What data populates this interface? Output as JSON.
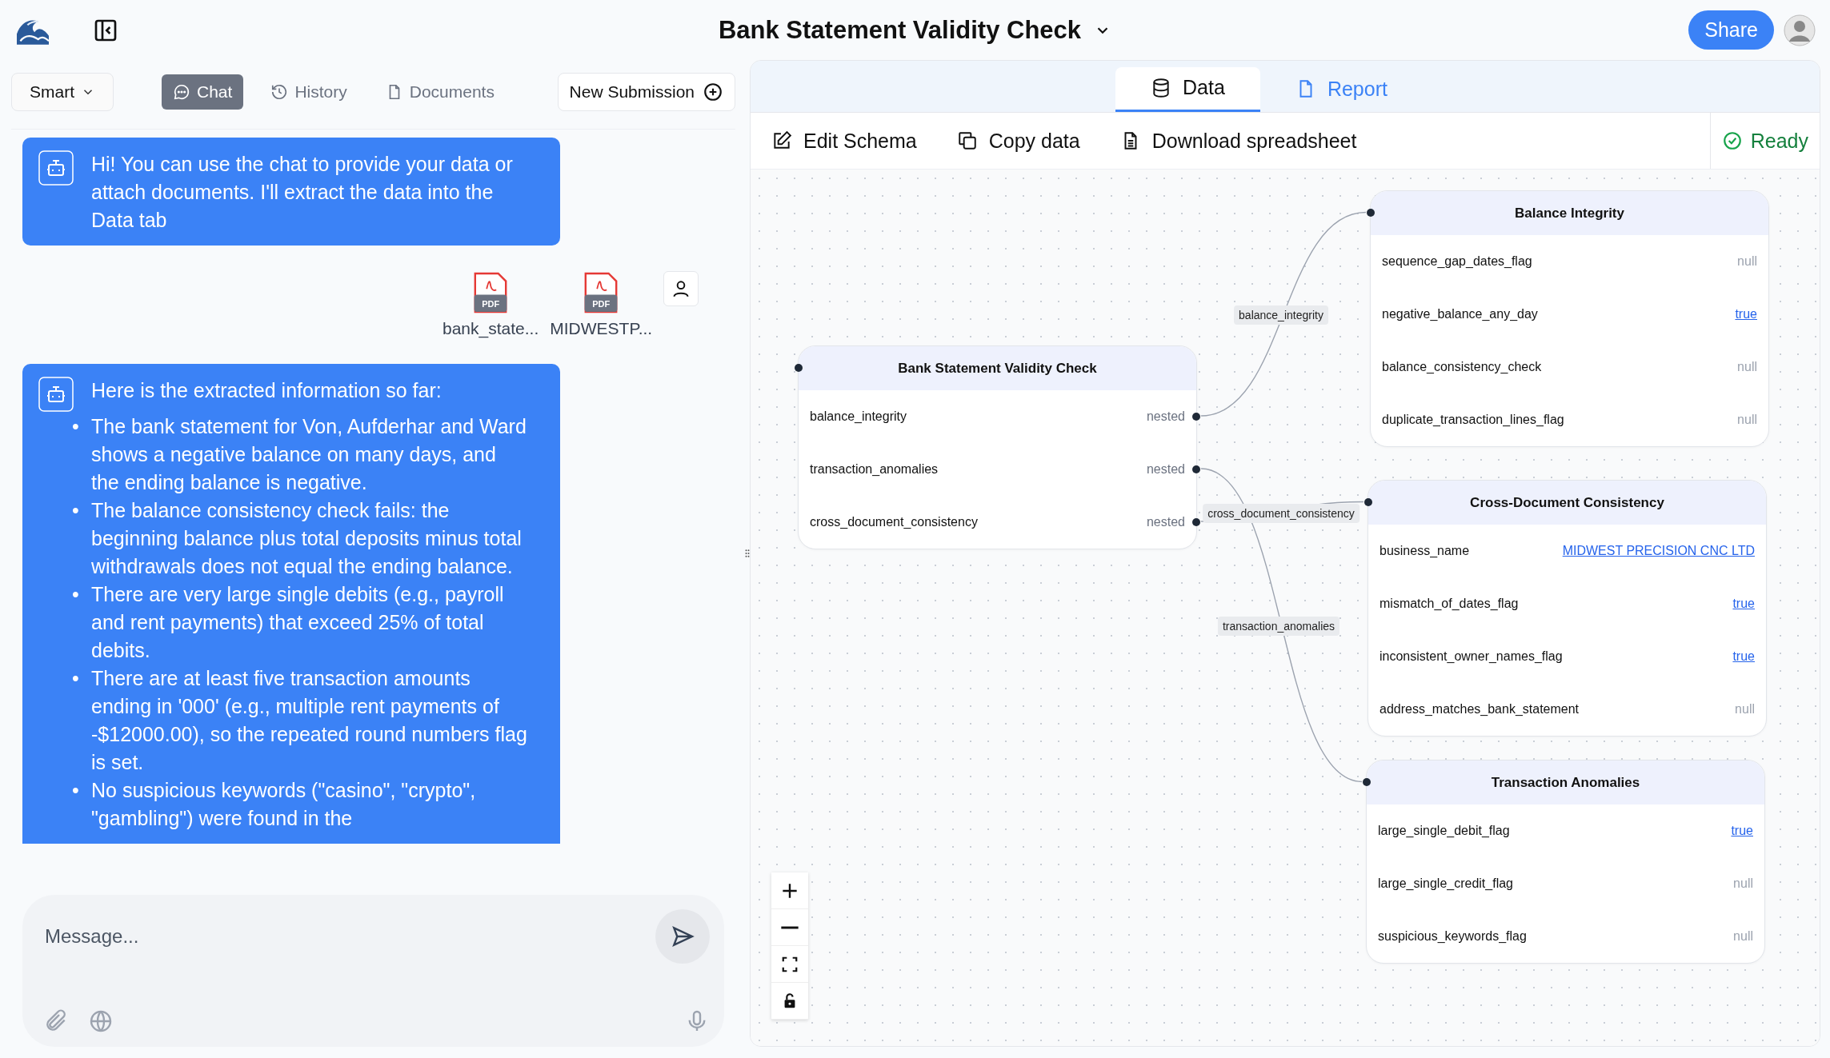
{
  "header": {
    "title": "Bank Statement Validity Check",
    "share": "Share"
  },
  "left": {
    "mode": "Smart",
    "tabs": [
      {
        "label": "Chat",
        "selected": true,
        "kind": "chat"
      },
      {
        "label": "History",
        "selected": false,
        "kind": "history"
      },
      {
        "label": "Documents",
        "selected": false,
        "kind": "documents"
      }
    ],
    "new_submission": "New Submission",
    "messages": [
      {
        "kind": "bot",
        "text": "Hi! You can use the chat to provide your data or attach documents. I'll extract the data into the Data tab"
      },
      {
        "kind": "attachments",
        "files": [
          {
            "name": "bank_state...",
            "badge": "PDF"
          },
          {
            "name": "MIDWESTP...",
            "badge": "PDF"
          }
        ]
      },
      {
        "kind": "bot",
        "text": "Here is the extracted information so far:",
        "bullets": [
          {
            "marker": "•",
            "text": "The bank statement for Von, Aufderhar and Ward shows a negative balance on many days, and the ending balance is negative."
          },
          {
            "marker": "•",
            "text": "The balance consistency check fails: the beginning balance plus total deposits minus total withdrawals does not equal the ending balance."
          },
          {
            "marker": "•",
            "text": "There are very large single debits (e.g., payroll and rent payments) that exceed 25% of total debits."
          },
          {
            "marker": "•",
            "text": "There are at least five transaction amounts ending in '000' (e.g., multiple rent payments of -$12000.00), so the repeated round numbers flag is set."
          },
          {
            "marker": "•",
            "text": "No suspicious keywords (\"casino\", \"crypto\", \"gambling\") were found in the"
          }
        ]
      }
    ],
    "composer": {
      "placeholder": "Message..."
    }
  },
  "right": {
    "tabs": [
      {
        "label": "Data",
        "selected": true,
        "kind": "data"
      },
      {
        "label": "Report",
        "selected": false,
        "kind": "report"
      }
    ],
    "actions": [
      {
        "label": "Edit Schema",
        "kind": "edit"
      },
      {
        "label": "Copy data",
        "kind": "copy"
      },
      {
        "label": "Download spreadsheet",
        "kind": "download"
      }
    ],
    "status": "Ready",
    "root": {
      "title": "Bank Statement Validity Check",
      "fields": [
        {
          "name": "balance_integrity",
          "value": "nested",
          "kind": "nested"
        },
        {
          "name": "transaction_anomalies",
          "value": "nested",
          "kind": "nested"
        },
        {
          "name": "cross_document_consistency",
          "value": "nested",
          "kind": "nested"
        }
      ]
    },
    "edges": [
      {
        "label": "balance_integrity"
      },
      {
        "label": "cross_document_consistency"
      },
      {
        "label": "transaction_anomalies"
      }
    ],
    "nodes": [
      {
        "title": "Balance Integrity",
        "fields": [
          {
            "name": "sequence_gap_dates_flag",
            "value": "null",
            "kind": "null"
          },
          {
            "name": "negative_balance_any_day",
            "value": "true",
            "kind": "link"
          },
          {
            "name": "balance_consistency_check",
            "value": "null",
            "kind": "null"
          },
          {
            "name": "duplicate_transaction_lines_flag",
            "value": "null",
            "kind": "null"
          }
        ]
      },
      {
        "title": "Cross-Document Consistency",
        "fields": [
          {
            "name": "business_name",
            "value": "MIDWEST PRECISION CNC LTD",
            "kind": "link"
          },
          {
            "name": "mismatch_of_dates_flag",
            "value": "true",
            "kind": "link"
          },
          {
            "name": "inconsistent_owner_names_flag",
            "value": "true",
            "kind": "link"
          },
          {
            "name": "address_matches_bank_statement",
            "value": "null",
            "kind": "null"
          }
        ]
      },
      {
        "title": "Transaction Anomalies",
        "fields": [
          {
            "name": "large_single_debit_flag",
            "value": "true",
            "kind": "link"
          },
          {
            "name": "large_single_credit_flag",
            "value": "null",
            "kind": "null"
          },
          {
            "name": "suspicious_keywords_flag",
            "value": "null",
            "kind": "null"
          }
        ]
      }
    ]
  }
}
